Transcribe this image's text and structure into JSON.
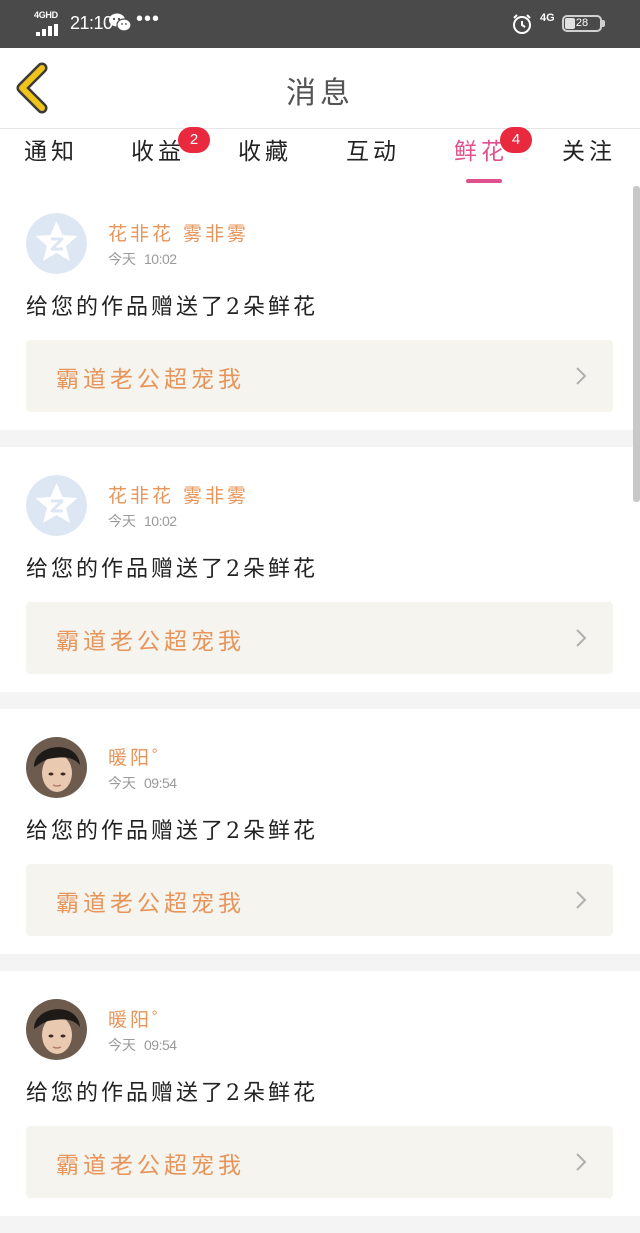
{
  "status_bar": {
    "network_label": "4GHD",
    "time": "21:10",
    "signal_4g": "4G",
    "battery": "28",
    "icons": [
      "signal-icon",
      "wechat-icon",
      "more-dots-icon",
      "alarm-icon",
      "battery-icon"
    ]
  },
  "header": {
    "title": "消息",
    "back_icon": "chevron-left-icon",
    "accent": "#f0c419"
  },
  "tabs": [
    {
      "label": "通知",
      "badge": ""
    },
    {
      "label": "收益",
      "badge": "2"
    },
    {
      "label": "收藏",
      "badge": ""
    },
    {
      "label": "互动",
      "badge": ""
    },
    {
      "label": "鲜花",
      "badge": "4",
      "active": true
    },
    {
      "label": "关注",
      "badge": ""
    }
  ],
  "colors": {
    "active_tab": "#e0508c",
    "badge": "#e8293e",
    "author": "#e7955a",
    "work_title": "#e7955a",
    "work_bg": "#f5f4ee"
  },
  "items": [
    {
      "author": "花非花 雾非雾",
      "time_prefix": "今天",
      "time": "10:02",
      "message": "给您的作品赠送了2朵鲜花",
      "work": "霸道老公超宠我",
      "avatar": "qq-default-avatar"
    },
    {
      "author": "花非花 雾非雾",
      "time_prefix": "今天",
      "time": "10:02",
      "message": "给您的作品赠送了2朵鲜花",
      "work": "霸道老公超宠我",
      "avatar": "qq-default-avatar"
    },
    {
      "author": "暖阳゜",
      "time_prefix": "今天",
      "time": "09:54",
      "message": "给您的作品赠送了2朵鲜花",
      "work": "霸道老公超宠我",
      "avatar": "user-photo-avatar"
    },
    {
      "author": "暖阳゜",
      "time_prefix": "今天",
      "time": "09:54",
      "message": "给您的作品赠送了2朵鲜花",
      "work": "霸道老公超宠我",
      "avatar": "user-photo-avatar"
    }
  ]
}
